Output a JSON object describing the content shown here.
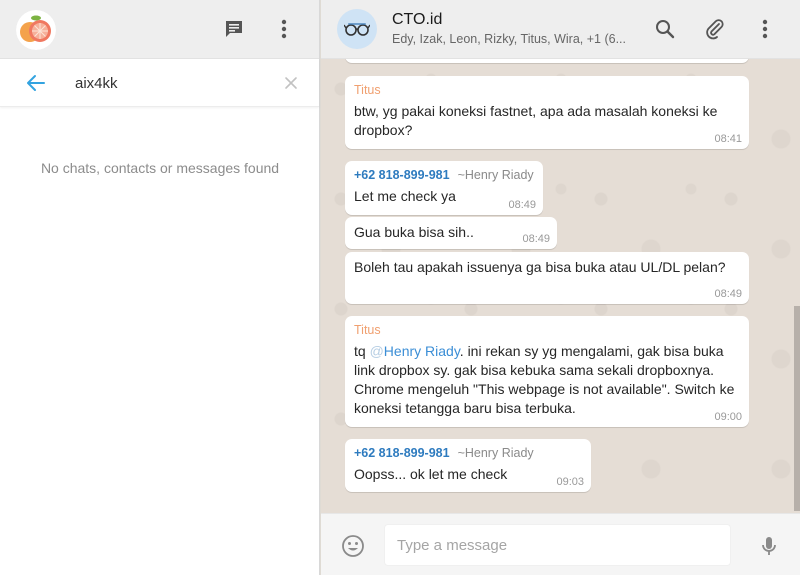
{
  "sidebar": {
    "search": {
      "value": "aix4kk"
    },
    "empty_state": "No chats, contacts or messages found"
  },
  "chat": {
    "title": "CTO.id",
    "members": "Edy, Izak, Leon, Rizky, Titus, Wira, +1 (6...",
    "messages": [
      {
        "sender": "Titus",
        "text": "btw, yg pakai koneksi fastnet, apa ada masalah koneksi ke dropbox?",
        "time": "08:41"
      },
      {
        "sender_phone": "+62 818-899-981",
        "sender_alias": "~Henry Riady",
        "text": "Let me check ya",
        "time": "08:49"
      },
      {
        "text": "Gua buka bisa sih..",
        "time": "08:49"
      },
      {
        "text": "Boleh tau apakah issuenya ga bisa buka atau UL/DL pelan?",
        "time": "08:49"
      },
      {
        "sender": "Titus",
        "text_prefix": "tq ",
        "mention_at": "@",
        "mention": "Henry Riady",
        "text": ". ini rekan sy yg mengalami, gak bisa buka link dropbox sy. gak bisa kebuka sama sekali dropboxnya. Chrome mengeluh \"This webpage is not available\". Switch ke koneksi tetangga baru bisa terbuka.",
        "time": "09:00"
      },
      {
        "sender_phone": "+62 818-899-981",
        "sender_alias": "~Henry Riady",
        "text": "Oopss... ok let me check",
        "time": "09:03"
      }
    ]
  },
  "composer": {
    "placeholder": "Type a message"
  }
}
